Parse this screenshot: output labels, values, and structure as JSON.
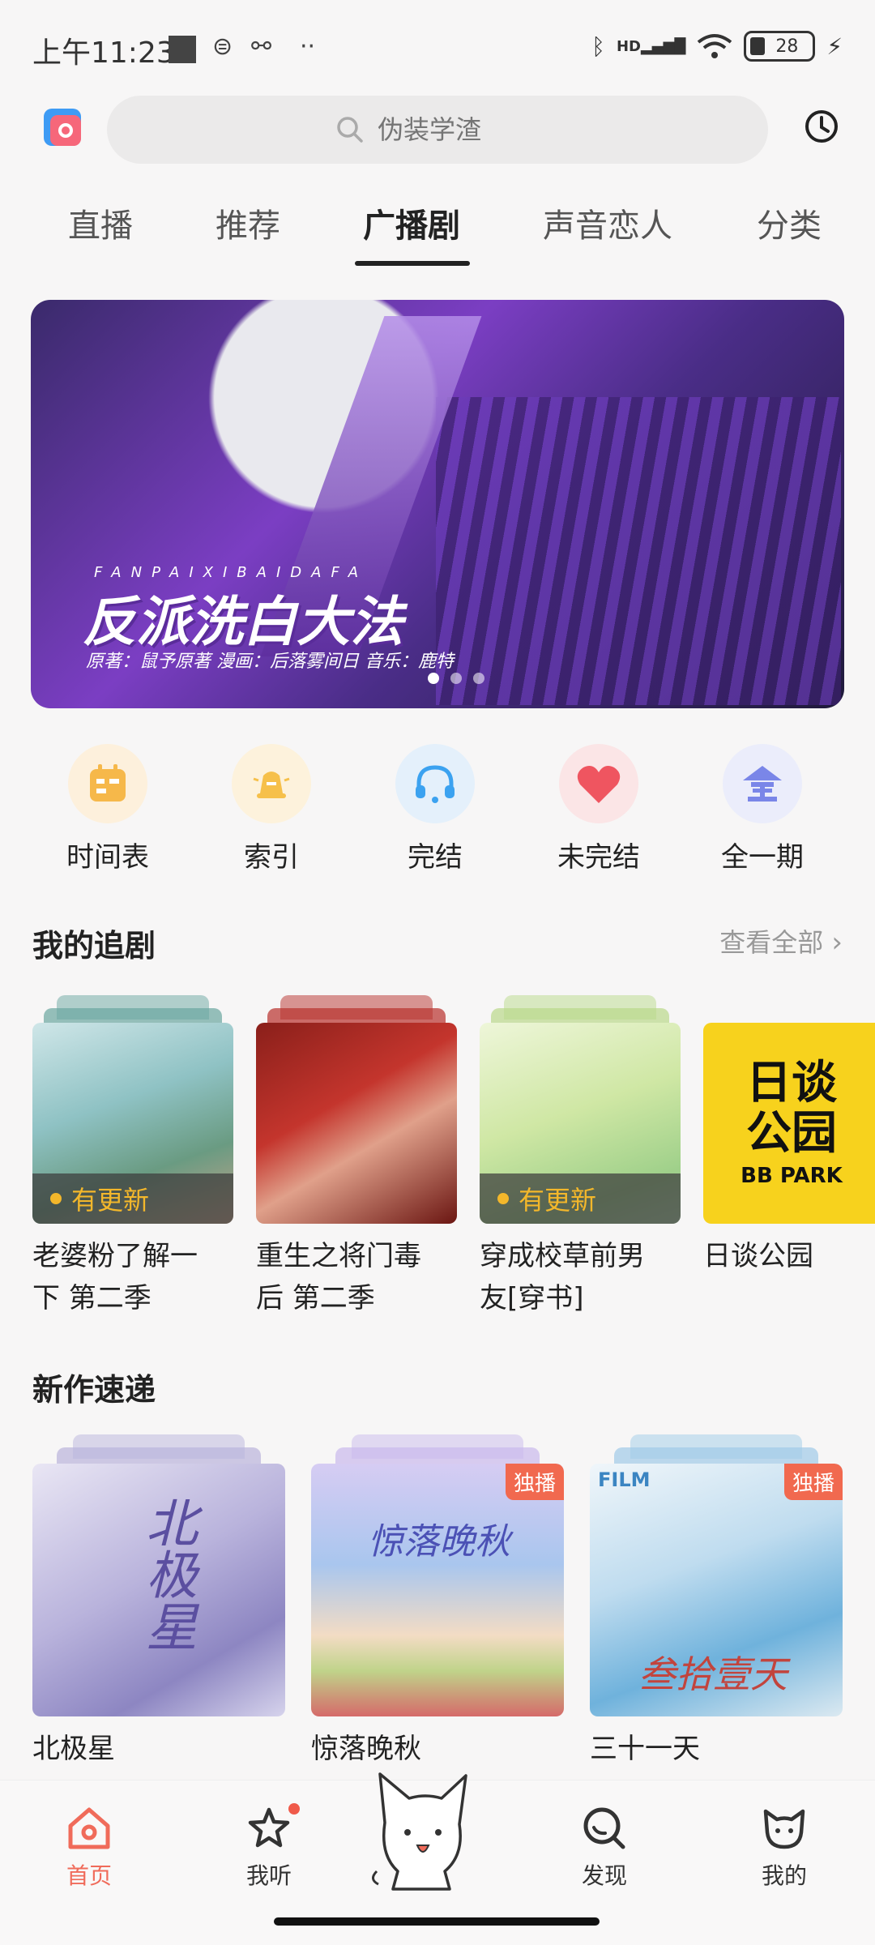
{
  "status_bar": {
    "time": "上午11:23",
    "battery": "28",
    "signal_label": "HD"
  },
  "header": {
    "search_placeholder": "伪装学渣"
  },
  "tabs": [
    {
      "label": "直播"
    },
    {
      "label": "推荐"
    },
    {
      "label": "广播剧",
      "active": true
    },
    {
      "label": "声音恋人"
    },
    {
      "label": "分类"
    }
  ],
  "banner": {
    "subtitle": "FANPAIXIBAIDAFA",
    "title": "反派洗白大法",
    "credits": "原著：鼠予原著    漫画：后落雾间日    音乐：鹿特",
    "dot_count": 3,
    "active_dot": 0
  },
  "quick_links": [
    {
      "label": "时间表",
      "icon": "calendar-icon",
      "color": "#f6b84a",
      "bg": "#fdf0dc"
    },
    {
      "label": "索引",
      "icon": "bell-index-icon",
      "color": "#f6c04a",
      "bg": "#fdf2dc"
    },
    {
      "label": "完结",
      "icon": "headphones-icon",
      "color": "#3ba2f0",
      "bg": "#e4f0fb"
    },
    {
      "label": "未完结",
      "icon": "heart-icon",
      "color": "#ef5560",
      "bg": "#fbe5e6"
    },
    {
      "label": "全一期",
      "icon": "full-badge-icon",
      "color": "#7a86e8",
      "bg": "#ebedfb"
    }
  ],
  "following": {
    "title": "我的追剧",
    "see_all": "查看全部",
    "items": [
      {
        "title_line1": "老婆粉了解一",
        "title_line2": "下 第二季",
        "update": "有更新",
        "has_update": true,
        "color": "#6aa6a0"
      },
      {
        "title_line1": "重生之将门毒",
        "title_line2": "后 第二季",
        "update": "",
        "has_update": false,
        "color": "#b8302c"
      },
      {
        "title_line1": "穿成校草前男",
        "title_line2": "友[穿书]",
        "update": "有更新",
        "has_update": true,
        "color": "#b9d98a"
      },
      {
        "title_line1": "日谈公园",
        "title_line2": "",
        "update": "",
        "has_update": false,
        "color": "#f7d21d",
        "cover_text": "日谈公园",
        "cover_sub": "BB PARK"
      }
    ]
  },
  "new_works": {
    "title": "新作速递",
    "items": [
      {
        "title": "北极星",
        "exclusive": "",
        "color": "#b9b3dc",
        "cover_text": "北极星"
      },
      {
        "title": "惊落晚秋",
        "exclusive": "独播",
        "color": "#c9b9ec",
        "cover_text": "惊落晚秋"
      },
      {
        "title": "三十一天",
        "exclusive": "独播",
        "color": "#9fcbe8",
        "cover_text": "叁拾壹天",
        "film_label": "FILM"
      }
    ]
  },
  "bottom_nav": [
    {
      "label": "首页",
      "icon": "home-icon",
      "active": true
    },
    {
      "label": "我听",
      "icon": "star-icon",
      "badge": true
    },
    {
      "label": "",
      "icon": "cat-mascot-icon"
    },
    {
      "label": "发现",
      "icon": "discover-icon"
    },
    {
      "label": "我的",
      "icon": "cat-face-icon"
    }
  ]
}
